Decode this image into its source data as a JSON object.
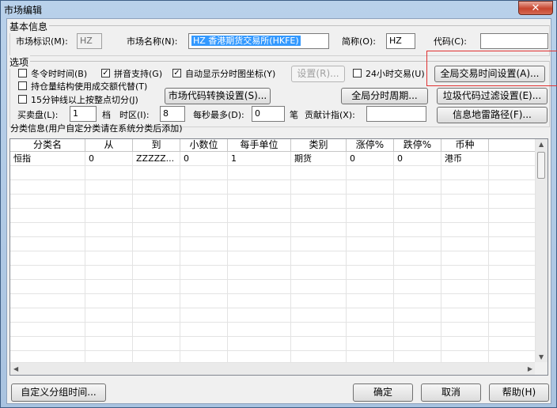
{
  "window": {
    "title": "市场编辑",
    "close_symbol": "✕"
  },
  "basic": {
    "group_label": "基本信息",
    "market_id_label": "市场标识(M):",
    "market_id_value": "HZ",
    "market_name_label": "市场名称(N):",
    "market_name_value": "HZ 香港期货交易所(HKFE)",
    "short_name_label": "简称(O):",
    "short_name_value": "HZ",
    "code_label": "代码(C):",
    "code_value": ""
  },
  "options": {
    "group_label": "选项",
    "winter_time": {
      "label": "冬令时时间(B)",
      "checked": false
    },
    "pinyin": {
      "label": "拼音支持(G)",
      "checked": true
    },
    "auto_coords": {
      "label": "自动显示分时图坐标(Y)",
      "checked": true
    },
    "settings_button": "设置(R)...",
    "hours24": {
      "label": "24小时交易(U)",
      "checked": false
    },
    "global_time_button": "全局交易时间设置(A)...",
    "position_structure": {
      "label": "持仓量结构使用成交额代替(T)",
      "checked": false
    },
    "market_code_convert_button": "市场代码转换设置(S)...",
    "global_period_button": "全局分时周期...",
    "junk_filter_button": "垃圾代码过滤设置(E)...",
    "min15": {
      "label": "15分钟线以上按整点切分(J)",
      "checked": false
    },
    "bid_ask_label": "买卖盘(L):",
    "bid_ask_value": "1",
    "dang_label": "档",
    "timezone_label": "时区(I):",
    "timezone_value": "8",
    "per_second_label": "每秒最多(D):",
    "per_second_value": "0",
    "bi_label": "笔",
    "contribution_label": "贡献计指(X):",
    "contribution_value": "",
    "info_path_button": "信息地雷路径(F)..."
  },
  "categories": {
    "group_label": "分类信息(用户自定分类请在系统分类后添加)",
    "columns": [
      "分类名",
      "从",
      "到",
      "小数位",
      "每手单位",
      "类别",
      "涨停%",
      "跌停%",
      "币种"
    ],
    "rows": [
      [
        "恒指",
        "0",
        "ZZZZZ...",
        "0",
        "1",
        "期货",
        "0",
        "0",
        "港币"
      ]
    ]
  },
  "footer": {
    "custom_group_time_button": "自定义分组时间...",
    "ok_button": "确定",
    "cancel_button": "取消",
    "help_button": "帮助(H)"
  },
  "colors": {
    "highlight_box": "#e03030",
    "selection": "#3399ff"
  }
}
